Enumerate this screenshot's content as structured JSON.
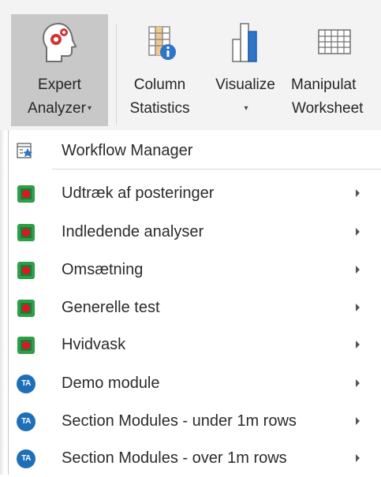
{
  "ribbon": {
    "buttons": [
      {
        "id": "expert-analyzer",
        "line1": "Expert",
        "line2": "Analyzer",
        "has_dropdown": true,
        "icon": "head-gears-icon"
      },
      {
        "id": "column-statistics",
        "line1": "Column",
        "line2": "Statistics",
        "has_dropdown": false,
        "icon": "table-info-icon"
      },
      {
        "id": "visualize",
        "line1": "Visualize",
        "line2": "",
        "has_dropdown": true,
        "icon": "bar-chart-icon"
      },
      {
        "id": "manipulate-worksheet",
        "line1": "Manipulat",
        "line2": "Worksheet",
        "has_dropdown": false,
        "icon": "grid-icon"
      }
    ],
    "dropdown_caret": "▾"
  },
  "menu": {
    "items": [
      {
        "label": "Workflow Manager",
        "icon": "workflow-icon",
        "submenu": false
      },
      {
        "label": "Udtræk af posteringer",
        "icon": "module-icon",
        "submenu": true
      },
      {
        "label": "Indledende analyser",
        "icon": "module-icon",
        "submenu": true
      },
      {
        "label": "Omsætning",
        "icon": "module-icon",
        "submenu": true
      },
      {
        "label": "Generelle test",
        "icon": "module-icon",
        "submenu": true
      },
      {
        "label": "Hvidvask",
        "icon": "module-icon",
        "submenu": true
      },
      {
        "label": "Demo module",
        "icon": "ta-icon",
        "submenu": true
      },
      {
        "label": "Section Modules - under 1m rows",
        "icon": "ta-icon",
        "submenu": true
      },
      {
        "label": "Section Modules - over 1m rows",
        "icon": "ta-icon",
        "submenu": true
      }
    ],
    "ta_badge": "TA"
  },
  "colors": {
    "ribbon_bg": "#f3f3f3",
    "active_button_bg": "#c8c8c8",
    "head_icon_red": "#d13438",
    "chart_blue": "#2e75c8",
    "ta_blue": "#1e6fb8",
    "module_green": "#2e9e48",
    "module_red": "#e81123"
  }
}
